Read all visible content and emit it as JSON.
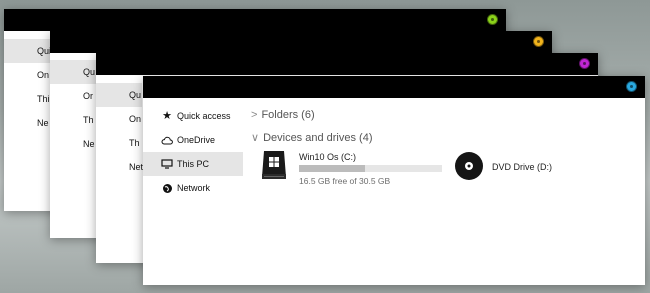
{
  "windows": [
    {
      "accent": "#8bd11a",
      "nav": [
        {
          "label": "Quic",
          "icon": "star-icon",
          "selected": true
        },
        {
          "label": "On",
          "icon": "cloud-icon"
        },
        {
          "label": "Thi",
          "icon": "monitor-icon"
        },
        {
          "label": "Ne",
          "icon": "network-icon"
        }
      ]
    },
    {
      "accent": "#f1b31c",
      "nav": [
        {
          "label": "Qu",
          "icon": "star-icon",
          "selected": true
        },
        {
          "label": "Or",
          "icon": "cloud-icon"
        },
        {
          "label": "Th",
          "icon": "monitor-icon"
        },
        {
          "label": "Ne",
          "icon": "network-icon"
        }
      ]
    },
    {
      "accent": "#c026d3",
      "nav": [
        {
          "label": "Qu",
          "icon": "star-icon",
          "selected": true
        },
        {
          "label": "On",
          "icon": "cloud-icon"
        },
        {
          "label": "Th",
          "icon": "monitor-icon"
        },
        {
          "label": "Net",
          "icon": "network-icon"
        }
      ]
    },
    {
      "accent": "#29a8e0",
      "nav": [
        {
          "label": "Quick access",
          "icon": "star-icon"
        },
        {
          "label": "OneDrive",
          "icon": "cloud-icon"
        },
        {
          "label": "This PC",
          "icon": "monitor-icon",
          "selected": true
        },
        {
          "label": "Network",
          "icon": "network-icon"
        }
      ],
      "groups": {
        "folders": "Folders (6)",
        "devices": "Devices and drives (4)"
      },
      "drives": [
        {
          "name": "Win10 Os (C:)",
          "free": "16.5 GB free of 30.5 GB",
          "used_fraction": 0.46,
          "icon": "windows-drive-icon"
        },
        {
          "name": "DVD Drive (D:)",
          "icon": "dvd-icon"
        }
      ]
    }
  ]
}
